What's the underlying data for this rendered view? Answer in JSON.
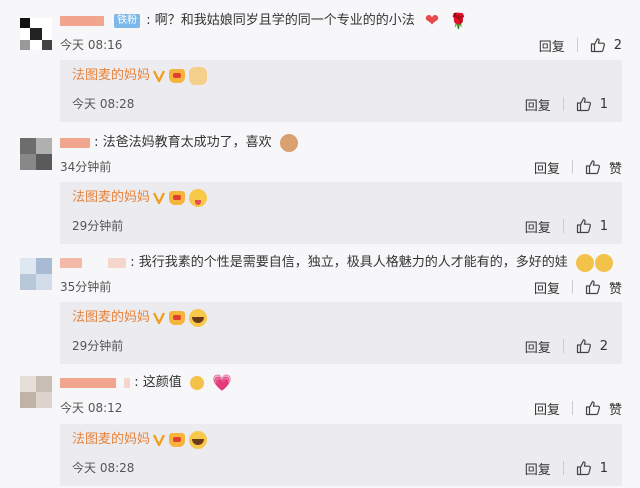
{
  "icons": {
    "like": "thumbs-up-icon",
    "heart": "❤",
    "rose": "🌹",
    "pink_heart": "💗"
  },
  "colors": {
    "nickname_orange": "#e8823a",
    "fan_badge": "#7cb8ea",
    "reply_bg": "#ececf0"
  },
  "comments": [
    {
      "fan_badge": "铁粉",
      "text": "啊？和我姑娘同岁且学的同一个专业的的小法",
      "time": "今天 08:16",
      "reply_label": "回复",
      "like_count": "2",
      "reply": {
        "author": "法图麦的妈妈",
        "time": "今天 08:28",
        "reply_label": "回复",
        "like_count": "1"
      }
    },
    {
      "text": "法爸法妈教育太成功了，喜欢",
      "time": "34分钟前",
      "reply_label": "回复",
      "like_count": "赞",
      "reply": {
        "author": "法图麦的妈妈",
        "time": "29分钟前",
        "reply_label": "回复",
        "like_count": "1"
      }
    },
    {
      "text": "我行我素的个性是需要自信，独立，极具人格魅力的人才能有的，多好的娃",
      "time": "35分钟前",
      "reply_label": "回复",
      "like_count": "赞",
      "reply": {
        "author": "法图麦的妈妈",
        "time": "29分钟前",
        "reply_label": "回复",
        "like_count": "2"
      }
    },
    {
      "text": "这颜值",
      "time": "今天 08:12",
      "reply_label": "回复",
      "like_count": "赞",
      "reply": {
        "author": "法图麦的妈妈",
        "time": "今天 08:28",
        "reply_label": "回复",
        "like_count": "1"
      }
    }
  ]
}
